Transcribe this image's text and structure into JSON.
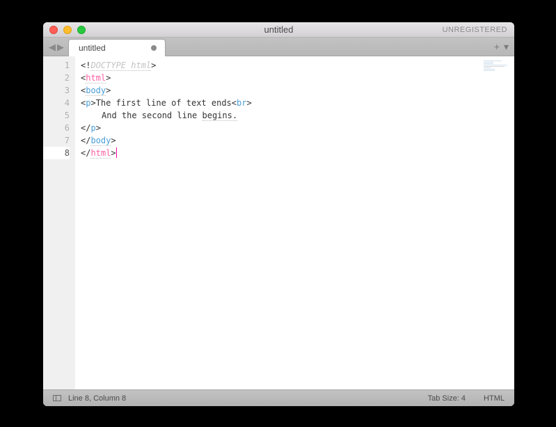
{
  "window": {
    "title": "untitled",
    "registration": "UNREGISTERED"
  },
  "tabs": {
    "active": {
      "label": "untitled",
      "dirty": true
    }
  },
  "editor": {
    "line_numbers": [
      "1",
      "2",
      "3",
      "4",
      "5",
      "6",
      "7",
      "8"
    ],
    "current_line_index": 7,
    "lines": [
      {
        "tokens": [
          {
            "t": "<!",
            "c": "c-punct"
          },
          {
            "t": "DOCTYPE html",
            "c": "c-doctype underline-dotted"
          },
          {
            "t": ">",
            "c": "c-punct"
          }
        ]
      },
      {
        "tokens": [
          {
            "t": "<",
            "c": "c-punct"
          },
          {
            "t": "html",
            "c": "c-tag2 underline-dotted"
          },
          {
            "t": ">",
            "c": "c-punct"
          }
        ]
      },
      {
        "tokens": [
          {
            "t": "<",
            "c": "c-punct"
          },
          {
            "t": "body",
            "c": "c-tag underline-dotted"
          },
          {
            "t": ">",
            "c": "c-punct"
          }
        ]
      },
      {
        "tokens": [
          {
            "t": "<",
            "c": "c-punct"
          },
          {
            "t": "p",
            "c": "c-tag"
          },
          {
            "t": ">",
            "c": "c-punct"
          },
          {
            "t": "The first line of text ends",
            "c": "c-body"
          },
          {
            "t": "<",
            "c": "c-punct"
          },
          {
            "t": "br",
            "c": "c-tag"
          },
          {
            "t": ">",
            "c": "c-punct"
          }
        ]
      },
      {
        "indent": true,
        "tokens": [
          {
            "t": "And the second line ",
            "c": "c-body"
          },
          {
            "t": "begins.",
            "c": "c-body underline-dotted"
          }
        ]
      },
      {
        "tokens": [
          {
            "t": "</",
            "c": "c-punct"
          },
          {
            "t": "p",
            "c": "c-tag"
          },
          {
            "t": ">",
            "c": "c-punct"
          }
        ]
      },
      {
        "tokens": [
          {
            "t": "</",
            "c": "c-punct"
          },
          {
            "t": "body",
            "c": "c-tag underline-dotted"
          },
          {
            "t": ">",
            "c": "c-punct"
          }
        ]
      },
      {
        "cursor_after": true,
        "tokens": [
          {
            "t": "</",
            "c": "c-punct"
          },
          {
            "t": "html",
            "c": "c-tag2 underline-dotted"
          },
          {
            "t": ">",
            "c": "c-punct"
          }
        ]
      }
    ]
  },
  "status": {
    "position": "Line 8, Column 8",
    "tab_size": "Tab Size: 4",
    "syntax": "HTML"
  },
  "nav": {
    "back": "◀",
    "fwd": "▶"
  },
  "tabbar_right": {
    "plus": "+",
    "more": "▾"
  }
}
